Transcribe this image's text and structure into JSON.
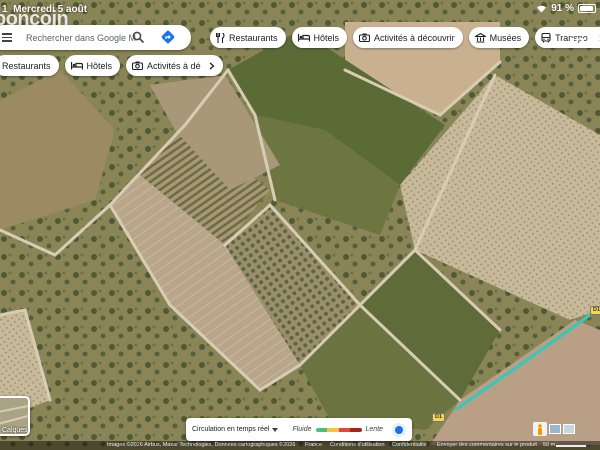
{
  "status_bar": {
    "time": "1",
    "date": "Mercredi 5 août",
    "battery": "91 %",
    "battery_level": 0.91
  },
  "watermark": "boncoin",
  "search": {
    "placeholder": "Rechercher dans Google Maps",
    "menu_icon": "hamburger-menu-icon",
    "search_icon": "magnifier-icon",
    "directions_icon": "directions-diamond-icon"
  },
  "chips_row1": [
    {
      "icon": "fork-knife-icon",
      "label": "Restaurants"
    },
    {
      "icon": "bed-icon",
      "label": "Hôtels"
    },
    {
      "icon": "camera-icon",
      "label": "Activités à découvrir"
    },
    {
      "icon": "museum-icon",
      "label": "Musées"
    },
    {
      "icon": "bus-icon",
      "label": "Transpo"
    }
  ],
  "chips_row2": [
    {
      "icon": "fork-knife-icon",
      "label": "Restaurants"
    },
    {
      "icon": "bed-icon",
      "label": "Hôtels"
    },
    {
      "icon": "camera-icon",
      "label": "Activités à dé"
    }
  ],
  "traffic": {
    "title": "Circulation en temps réel",
    "fast_label": "Fluide",
    "slow_label": "Lente",
    "legend_colors": [
      "#4bc07a",
      "#f4c542",
      "#e8453c",
      "#a3251b"
    ]
  },
  "layers": {
    "label": "Calques"
  },
  "attribution": {
    "imagery": "Images ©2026 Airbus, Maxar Technologies, Données cartographiques ©2026",
    "country": "France",
    "terms": "Conditions d'utilisation",
    "privacy": "Confidentialité",
    "feedback": "Envoyer des commentaires sur le produit",
    "scale": "50 m"
  },
  "road_labels": [
    "D1",
    "D1"
  ],
  "colors": {
    "route_line": "#33c9b9",
    "chip_bg": "#ffffff",
    "accent": "#1a73e8"
  }
}
